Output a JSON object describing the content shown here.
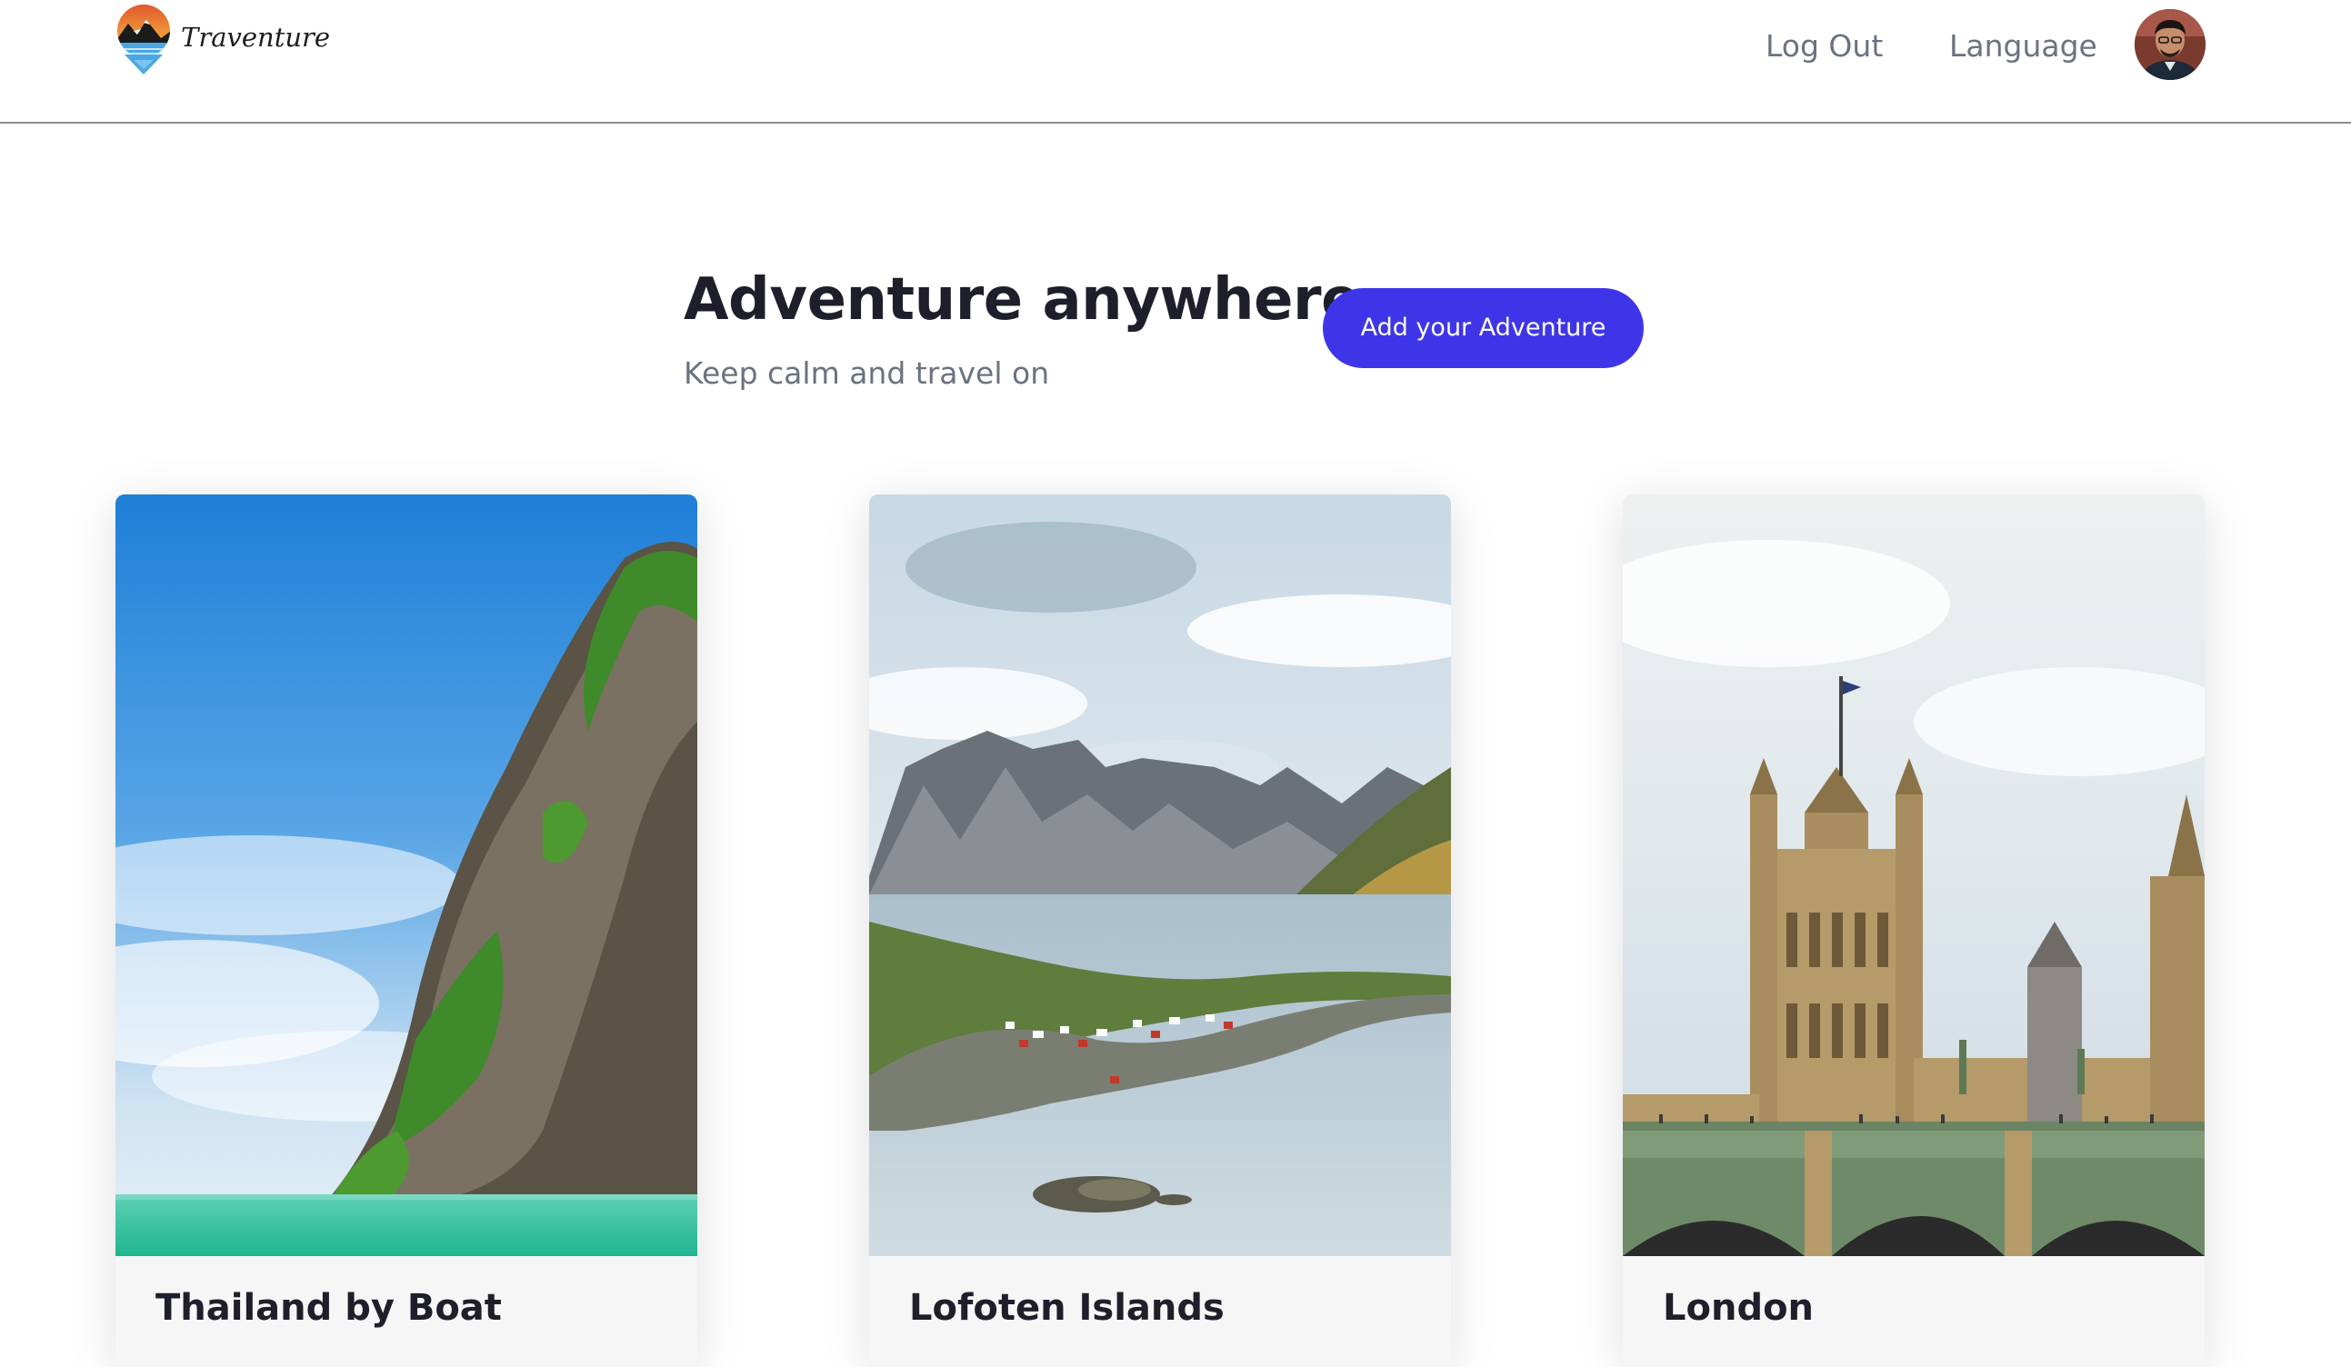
{
  "brand": {
    "name": "Traventure",
    "logo_icon": "mountain-sun-location-pin-icon"
  },
  "nav": {
    "logout_label": "Log Out",
    "language_label": "Language",
    "avatar": "user-avatar"
  },
  "hero": {
    "title": "Adventure anywhere",
    "subtitle": "Keep calm and travel on",
    "cta_label": "Add your Adventure"
  },
  "cards": [
    {
      "title": "Thailand by Boat",
      "image": "limestone-karst-island-sea"
    },
    {
      "title": "Lofoten Islands",
      "image": "fjord-mountains-village"
    },
    {
      "title": "London",
      "image": "palace-of-westminster-bridge"
    }
  ],
  "colors": {
    "accent": "#3f35e8",
    "text_primary": "#1f1f2b",
    "text_muted": "#6b7280",
    "header_border": "#8c8c8c"
  }
}
